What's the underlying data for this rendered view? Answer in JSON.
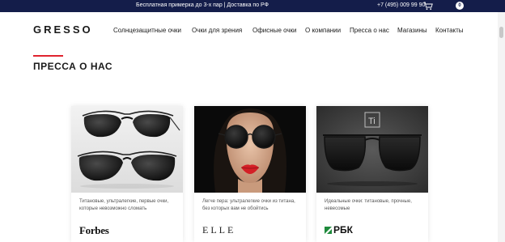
{
  "topbar": {
    "promo_text": "Бесплатная примерка до 3-х пар | Доставка по РФ",
    "phone": "+7 (495) 009 99 90",
    "cart_icon": "cart-icon",
    "cart_count": "0"
  },
  "header": {
    "logo": "GRESSO",
    "nav": [
      {
        "label": "Солнцезащитные очки"
      },
      {
        "label": "Очки для зрения"
      },
      {
        "label": "Офисные очки"
      },
      {
        "label": "О компании"
      },
      {
        "label": "Пресса о нас"
      },
      {
        "label": "Магазины"
      },
      {
        "label": "Контакты"
      }
    ]
  },
  "page": {
    "title": "ПРЕССА О НАС",
    "accent_color": "#e0242f",
    "topbar_color": "#141d4a"
  },
  "cards": [
    {
      "image": "aviator-sunglasses-photo",
      "caption": "Титановые, ультралегкие, первые очки, которые невозможно сломать",
      "brand": "Forbes"
    },
    {
      "image": "woman-round-sunglasses-photo",
      "caption": "Легче пера: ультралегкие очки из титана, без которых вам не обойтись",
      "brand": "ELLE"
    },
    {
      "image": "square-titanium-sunglasses-photo",
      "badge": "Ti",
      "caption": "Идеальные очки: титановые, прочные, невесомые",
      "brand": "РБК"
    }
  ]
}
